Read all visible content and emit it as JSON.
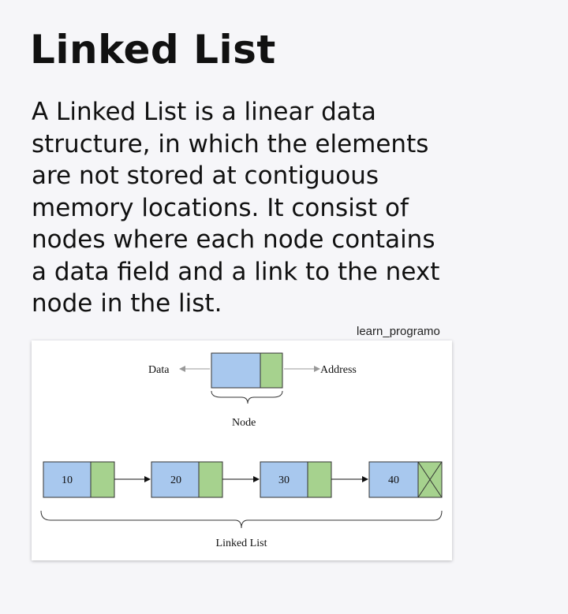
{
  "title": "Linked List",
  "description_lines": [
    "A Linked List is a linear data",
    "structure, in which the elements",
    "are not stored at contiguous",
    "memory locations. It consist of",
    "nodes where each node contains",
    "a data field and a link to the next",
    "node in the list."
  ],
  "watermark": "learn_programo",
  "diagram": {
    "node_labels": {
      "data": "Data",
      "address": "Address",
      "node": "Node"
    },
    "list_values": [
      "10",
      "20",
      "30",
      "40"
    ],
    "list_label": "Linked List",
    "colors": {
      "data_field": "#a8c8ee",
      "link_field": "#a6d28e",
      "border": "#333333",
      "arrow": "#111111",
      "guide_arrow": "#999999"
    }
  }
}
